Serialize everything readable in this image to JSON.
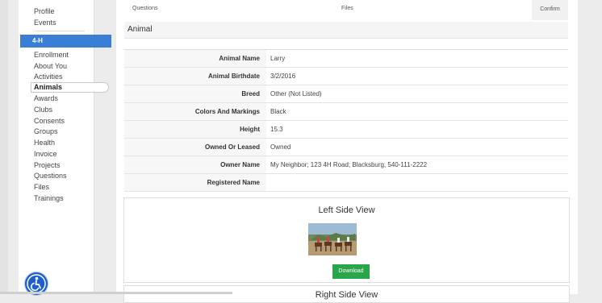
{
  "sidebar": {
    "top_items": [
      "Profile",
      "Events"
    ],
    "section_label": "4-H",
    "items": [
      "Enrollment",
      "About You",
      "Activities",
      "Animals",
      "Awards",
      "Clubs",
      "Consents",
      "Groups",
      "Health",
      "Invoice",
      "Projects",
      "Questions",
      "Files",
      "Trainings"
    ],
    "active_item": "Animals"
  },
  "tabs": {
    "questions": "Questions",
    "files": "Files",
    "confirm": "Confirm"
  },
  "section_title": "Animal",
  "animal": {
    "fields": [
      {
        "label": "Animal Name",
        "value": "Larry"
      },
      {
        "label": "Animal Birthdate",
        "value": "3/2/2016"
      },
      {
        "label": "Breed",
        "value": "Other (Not Listed)"
      },
      {
        "label": "Colors And Markings",
        "value": "Black"
      },
      {
        "label": "Height",
        "value": "15.3"
      },
      {
        "label": "Owned Or Leased",
        "value": "Owned"
      },
      {
        "label": "Owner Name",
        "value": "My Neighbor; 123 4H Road; Blacksburg, 540-111-2222"
      },
      {
        "label": "Registered Name",
        "value": ""
      }
    ]
  },
  "left_side_view": {
    "title": "Left Side View",
    "download_label": "Download"
  },
  "right_side_view": {
    "title": "Right Side View"
  },
  "icons": {
    "accessibility": "accessibility-icon",
    "photo": "horse-photo"
  },
  "colors": {
    "accent": "#3a7fd5",
    "download": "#2aa54a",
    "accessibility": "#1d5fd1"
  }
}
